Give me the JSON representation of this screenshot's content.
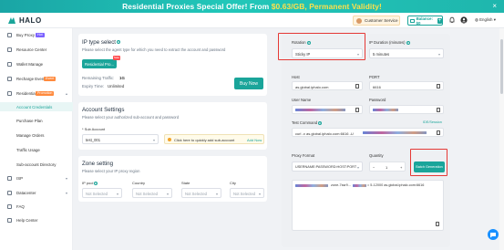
{
  "banner": {
    "pre": "Residential Proxies Special Offer! From ",
    "price": "$0.63/GB, Permanent Validity!",
    "close": "×"
  },
  "header": {
    "brand": "HALO",
    "customer_service": "Customer Service",
    "balance_label": "Balance: $0",
    "plus": "+",
    "language": "English"
  },
  "sidebar": {
    "items": [
      {
        "label": "Buy Proxy",
        "tag": "Hot"
      },
      {
        "label": "Resource Center"
      },
      {
        "label": "Wallet Manage"
      },
      {
        "label": "Recharge Event",
        "tag": "Event"
      },
      {
        "label": "Residential",
        "tag": "Promotion"
      },
      {
        "label": "Account Credentials"
      },
      {
        "label": "Purchase Plan"
      },
      {
        "label": "Manage Orders"
      },
      {
        "label": "Traffic Usage"
      },
      {
        "label": "Sub-account Directory"
      },
      {
        "label": "ISP"
      },
      {
        "label": "Datacenter"
      },
      {
        "label": "FAQ"
      },
      {
        "label": "Help Center"
      }
    ]
  },
  "ip_type": {
    "title": "IP type select",
    "desc": "Please select the agent type for which you need to extract the account and password",
    "option": "Residential Pro...",
    "badge": "Sale",
    "remaining_label": "Remaining Traffic:",
    "remaining_value": "1G",
    "expiry_label": "Expiry Time:",
    "expiry_value": "Unlimited",
    "buy_now": "Buy Now"
  },
  "account": {
    "title": "Account Settings",
    "desc": "Please select your authorized sub-account and password",
    "sub_label": "* Sub Account",
    "sub_value": "test_001",
    "hint": "Click here to quickly add sub-account",
    "add_now": "Add Now"
  },
  "zone": {
    "title": "Zone setting",
    "desc": "Please select your IP proxy region",
    "labels": [
      "IP pool",
      "Country",
      "State",
      "City"
    ],
    "placeholder": "Not Selected"
  },
  "right": {
    "rotation_label": "Rotation",
    "rotation_value": "Sticky IP",
    "duration_label": "IP Duration (minutes)",
    "duration_value": "5 minutes",
    "host_label": "Host",
    "host_value": "as.global.iphalo.com",
    "port_label": "PORT",
    "port_value": "6616",
    "user_label": "User Name",
    "pass_label": "Password",
    "test_label": "Test Command",
    "test_badge": "IDE/Session",
    "test_value": "curl -x as.global.iphalo.com:6616 -U",
    "format_label": "Proxy Format",
    "format_value": "USERNAME:PASSWORD:HOST:PORT",
    "qty_label": "Quantity",
    "qty_value": "1",
    "batch": "Batch Generation",
    "out_a": "zone-7ssr9...",
    "out_b": "= 5-12000 as.global.iphalo.com:6616",
    "minus": "−",
    "plus": "+"
  }
}
